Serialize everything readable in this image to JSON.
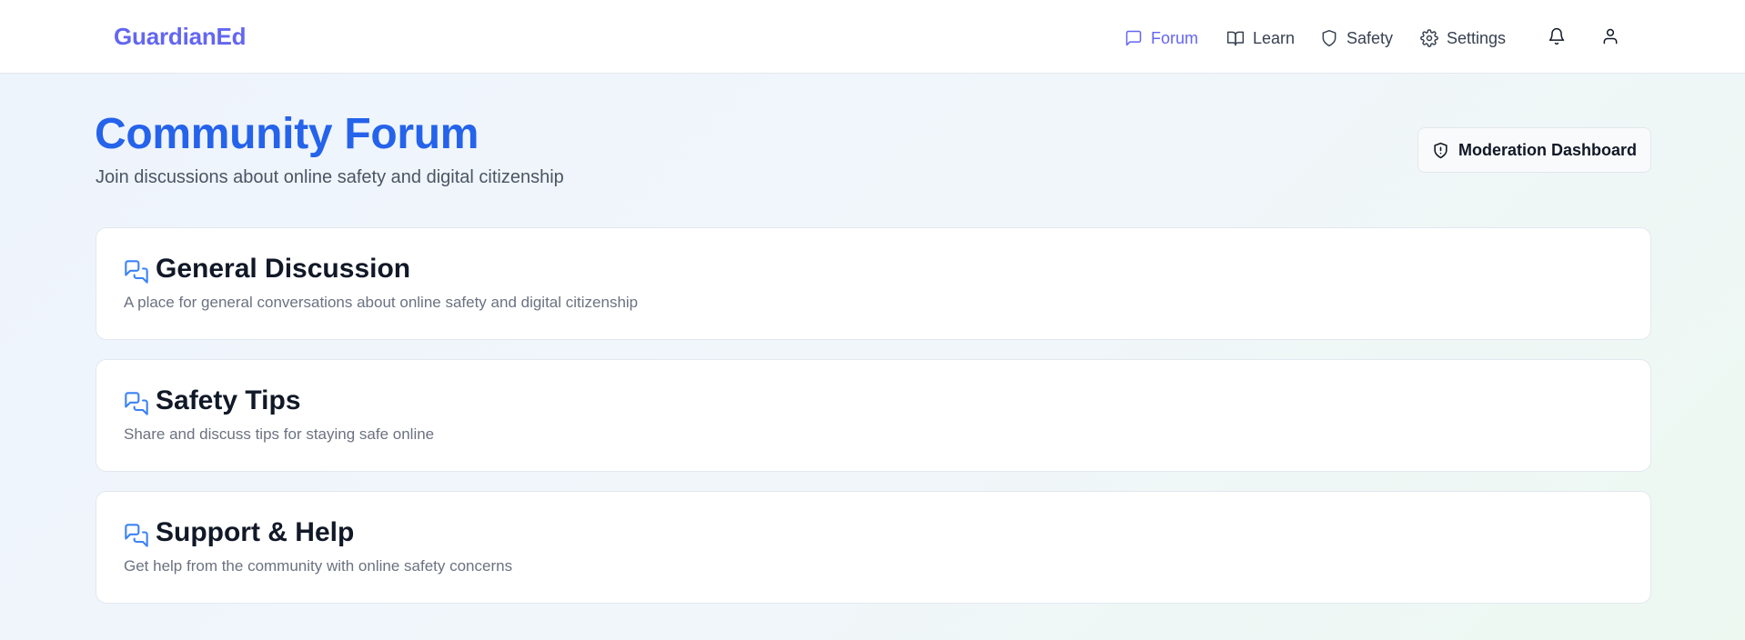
{
  "brand": "GuardianEd",
  "nav": {
    "forum": "Forum",
    "learn": "Learn",
    "safety": "Safety",
    "settings": "Settings"
  },
  "page": {
    "title": "Community Forum",
    "subtitle": "Join discussions about online safety and digital citizenship",
    "moderation_button": "Moderation Dashboard"
  },
  "categories": [
    {
      "title": "General Discussion",
      "description": "A place for general conversations about online safety and digital citizenship",
      "icon": "messages-icon"
    },
    {
      "title": "Safety Tips",
      "description": "Share and discuss tips for staying safe online",
      "icon": "messages-icon"
    },
    {
      "title": "Support & Help",
      "description": "Get help from the community with online safety concerns",
      "icon": "messages-icon"
    }
  ],
  "colors": {
    "brand": "#6366f1",
    "title": "#2563eb",
    "card_icon": "#3b82f6"
  }
}
